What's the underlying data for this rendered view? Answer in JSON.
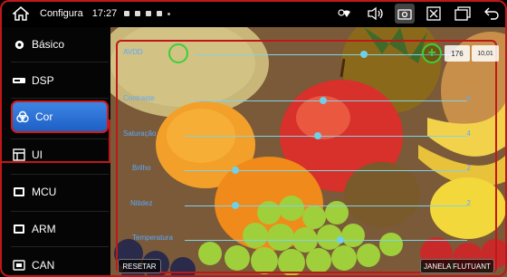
{
  "statusbar": {
    "title": "Configura",
    "time": "17:27"
  },
  "sidebar": {
    "items": [
      {
        "label": "Básico",
        "icon": "gear-icon"
      },
      {
        "label": "DSP",
        "icon": "dsp-icon"
      },
      {
        "label": "Cor",
        "icon": "color-icon"
      },
      {
        "label": "UI",
        "icon": "ui-icon"
      },
      {
        "label": "MCU",
        "icon": "chip-icon"
      },
      {
        "label": "ARM",
        "icon": "chip-icon"
      },
      {
        "label": "CAN",
        "icon": "can-icon"
      }
    ],
    "active_index": 2
  },
  "panel": {
    "sliders": [
      {
        "label": "AVDD",
        "value": "",
        "level": 0.62
      },
      {
        "label": "Contraste",
        "value": "4",
        "level": 0.47
      },
      {
        "label": "Saturação",
        "value": "4",
        "level": 0.47
      },
      {
        "label": "Brilho",
        "value": "2",
        "level": 0.18
      },
      {
        "label": "Nitidez",
        "value": "2",
        "level": 0.18
      },
      {
        "label": "Temperatura",
        "value": "",
        "level": 0.55
      }
    ],
    "counter_value": "176",
    "version_value": "10,01",
    "reset_label": "RESETAR",
    "float_label": "JANELA FLUTUANT"
  },
  "colors": {
    "accent": "#2f78dd",
    "highlight": "#c01818",
    "slider": "#6fd0e8"
  }
}
